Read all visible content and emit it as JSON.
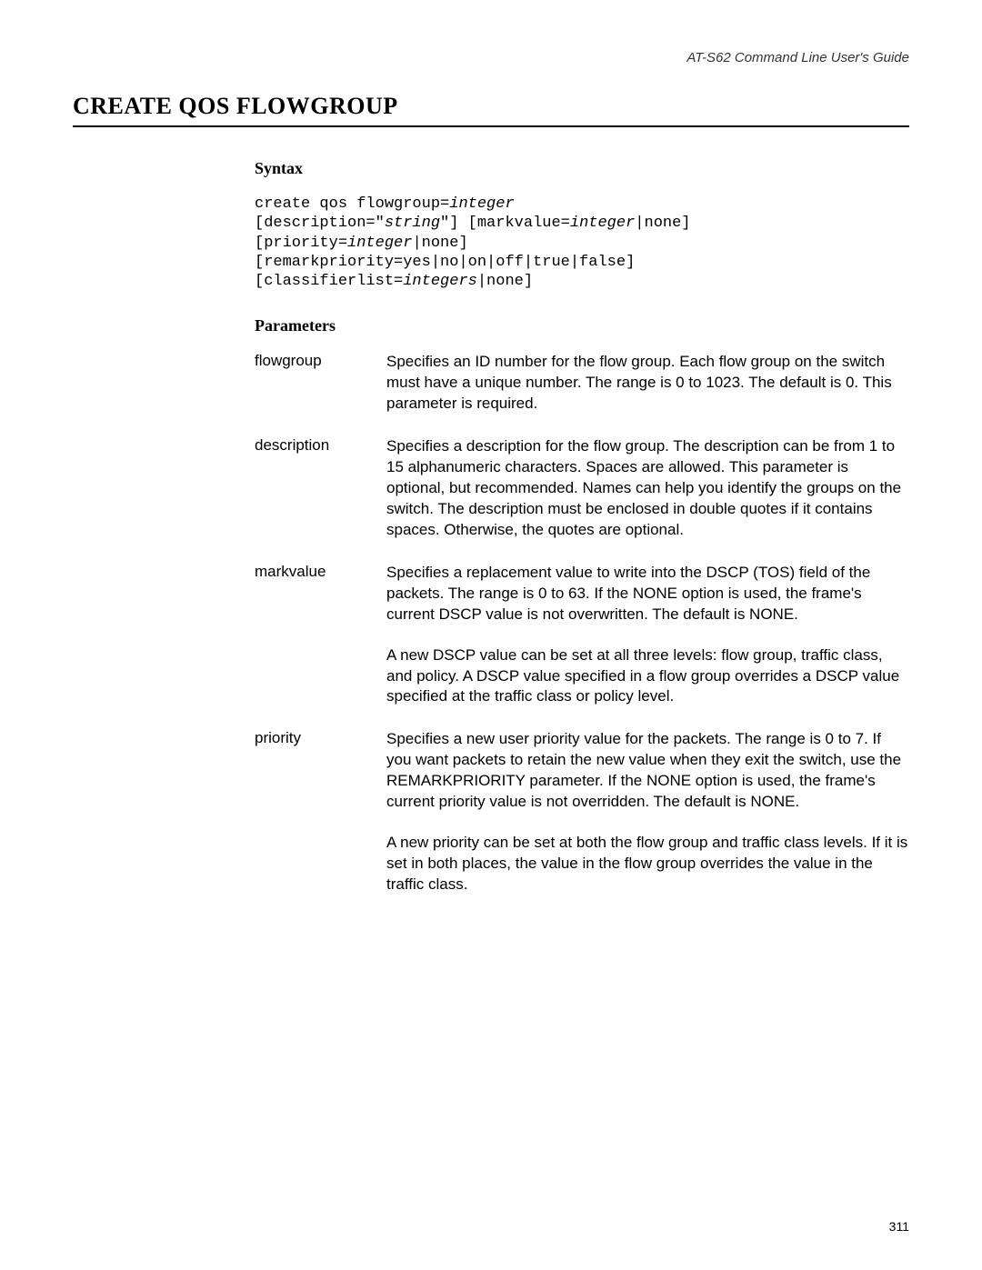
{
  "header": {
    "guide": "AT-S62 Command Line User's Guide"
  },
  "title": "CREATE QOS FLOWGROUP",
  "syntax": {
    "heading": "Syntax",
    "line1a": "create qos flowgroup=",
    "line1b": "integer",
    "line2a": "[description=\"",
    "line2b": "string",
    "line2c": "\"] [markvalue=",
    "line2d": "integer",
    "line2e": "|none]",
    "line3a": "[priority=",
    "line3b": "integer",
    "line3c": "|none]",
    "line4": "[remarkpriority=yes|no|on|off|true|false]",
    "line5a": "[classifierlist=",
    "line5b": "integers",
    "line5c": "|none]"
  },
  "parameters": {
    "heading": "Parameters",
    "items": [
      {
        "name": "flowgroup",
        "paras": [
          "Specifies an ID number for the flow group. Each flow group on the switch must have a unique number. The range is 0 to 1023. The default is 0. This parameter is required."
        ]
      },
      {
        "name": "description",
        "paras": [
          "Specifies a description for the flow group. The description can be from 1 to 15 alphanumeric characters. Spaces are allowed. This parameter is optional, but recommended. Names can help you identify the groups on the switch. The description must be enclosed in double quotes if it contains spaces. Otherwise, the quotes are optional."
        ]
      },
      {
        "name": "markvalue",
        "paras": [
          "Specifies a replacement value to write into the DSCP (TOS) field of the packets. The range is 0 to 63. If the NONE option is used, the frame's current DSCP value is not overwritten. The default is NONE.",
          "A new DSCP value can be set at all three levels: flow group, traffic class, and policy. A DSCP value specified in a flow group overrides a DSCP value specified at the traffic class or policy level."
        ]
      },
      {
        "name": "priority",
        "paras": [
          "Specifies a new user priority value for the packets. The range is 0 to 7. If you want packets to retain the new value when they exit the switch, use the REMARKPRIORITY parameter. If the NONE option is used, the frame's current priority value is not overridden. The default is NONE.",
          "A new priority can be set at both the flow group and traffic class levels. If it is set in both places, the value in the flow group overrides the value in the traffic class."
        ]
      }
    ]
  },
  "pageNumber": "311"
}
